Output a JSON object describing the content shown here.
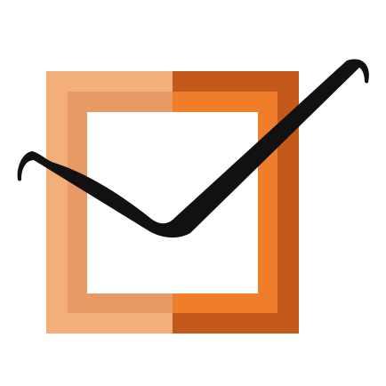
{
  "logo": {
    "colors": {
      "background": "#ffffff",
      "outer_left": "#f4ae7a",
      "inner_left": "#e89a64",
      "outer_right": "#c35a1b",
      "inner_right": "#f07d2a",
      "checkmark": "#111111"
    },
    "icons": [
      "checkbox-frame-icon",
      "checkmark-icon"
    ]
  }
}
